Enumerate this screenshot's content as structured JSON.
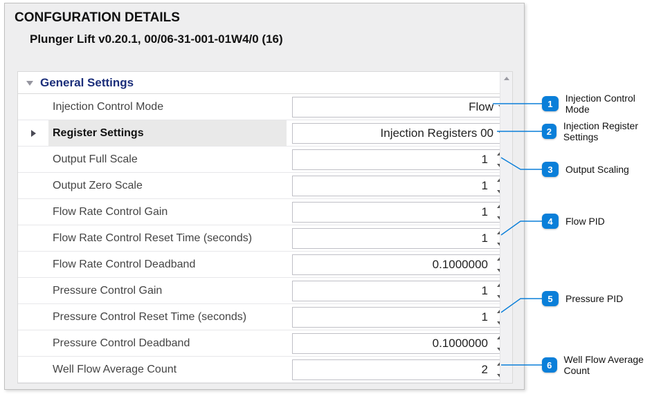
{
  "header": {
    "title": "CONFGURATION DETAILS",
    "subtitle": "Plunger Lift v0.20.1, 00/06-31-001-01W4/0  (16)"
  },
  "section": {
    "title": "General Settings"
  },
  "rows": [
    {
      "label": "Injection Control Mode",
      "value": "Flow",
      "type": "select"
    },
    {
      "label": "Register Settings",
      "value": "Injection Registers 00",
      "type": "select",
      "selected": true,
      "expander": true
    },
    {
      "label": "Output Full Scale",
      "value": "1",
      "type": "spin"
    },
    {
      "label": "Output Zero Scale",
      "value": "1",
      "type": "spin"
    },
    {
      "label": "Flow Rate Control Gain",
      "value": "1",
      "type": "spin"
    },
    {
      "label": "Flow Rate Control Reset Time (seconds)",
      "value": "1",
      "type": "spin"
    },
    {
      "label": "Flow Rate Control Deadband",
      "value": "0.1000000",
      "type": "spin"
    },
    {
      "label": "Pressure Control Gain",
      "value": "1",
      "type": "spin"
    },
    {
      "label": "Pressure Control Reset Time (seconds)",
      "value": "1",
      "type": "spin"
    },
    {
      "label": "Pressure Control Deadband",
      "value": "0.1000000",
      "type": "spin"
    },
    {
      "label": "Well Flow Average Count",
      "value": "2",
      "type": "spin"
    }
  ],
  "callouts": [
    {
      "n": "1",
      "text": "Injection Control Mode"
    },
    {
      "n": "2",
      "text": "Injection Register Settings"
    },
    {
      "n": "3",
      "text": "Output Scaling"
    },
    {
      "n": "4",
      "text": "Flow PID"
    },
    {
      "n": "5",
      "text": "Pressure PID"
    },
    {
      "n": "6",
      "text": "Well Flow Average Count"
    }
  ]
}
